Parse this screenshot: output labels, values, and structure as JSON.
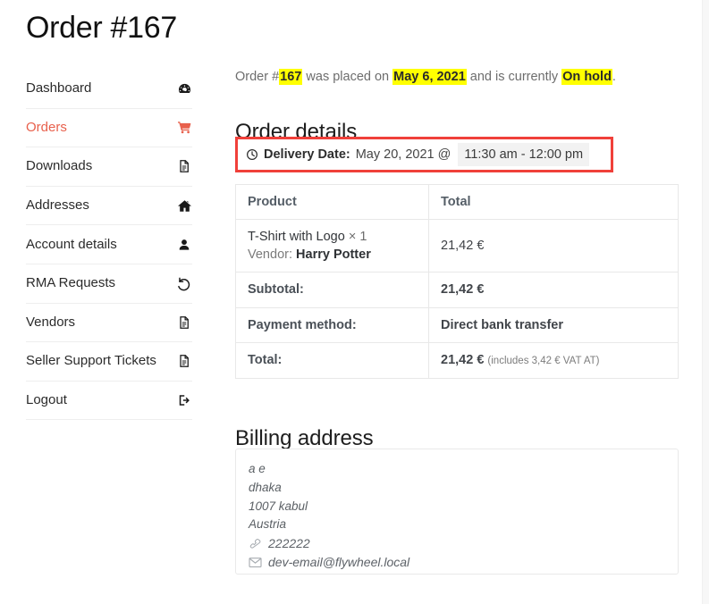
{
  "page": {
    "title": "Order #167"
  },
  "sidebar": {
    "items": [
      {
        "label": "Dashboard",
        "icon": "gauge-icon",
        "active": false
      },
      {
        "label": "Orders",
        "icon": "shopping-cart-icon",
        "active": true
      },
      {
        "label": "Downloads",
        "icon": "document-icon",
        "active": false
      },
      {
        "label": "Addresses",
        "icon": "home-icon",
        "active": false
      },
      {
        "label": "Account details",
        "icon": "user-icon",
        "active": false
      },
      {
        "label": "RMA Requests",
        "icon": "undo-arrow-icon",
        "active": false
      },
      {
        "label": "Vendors",
        "icon": "document-icon",
        "active": false
      },
      {
        "label": "Seller Support Tickets",
        "icon": "document-icon",
        "active": false
      },
      {
        "label": "Logout",
        "icon": "sign-out-icon",
        "active": false
      }
    ]
  },
  "main": {
    "notice": {
      "prefix": "Order #",
      "order_number": "167",
      "mid": " was placed on ",
      "order_date": "May 6, 2021",
      "and_is": " and is currently ",
      "status": "On hold",
      "suffix": "."
    },
    "headings": {
      "order_details": "Order details",
      "billing_address": "Billing address"
    },
    "delivery": {
      "label": "Delivery Date:",
      "date": "May 20, 2021 @",
      "time_slot": "11:30 am - 12:00 pm"
    },
    "table": {
      "headers": [
        "Product",
        "Total"
      ],
      "item": {
        "name": "T-Shirt with Logo",
        "qty": "× 1",
        "vendor_label": "Vendor:",
        "vendor_name": "Harry Potter",
        "total": "21,42 €"
      },
      "rows": [
        {
          "label": "Subtotal:",
          "value": "21,42 €",
          "note": ""
        },
        {
          "label": "Payment method:",
          "value": "Direct bank transfer",
          "note": ""
        },
        {
          "label": "Total:",
          "value": "21,42 €",
          "note": "(includes 3,42 € VAT AT)"
        }
      ]
    },
    "address": {
      "lines": [
        "a e",
        "dhaka",
        "1007 kabul",
        "Austria"
      ],
      "phone": "222222",
      "email": "dev-email@flywheel.local"
    }
  },
  "colors": {
    "accent": "#e8604c",
    "highlight": "#ffff00",
    "alert_border": "#f0403a",
    "text": "#2b2b2b"
  }
}
